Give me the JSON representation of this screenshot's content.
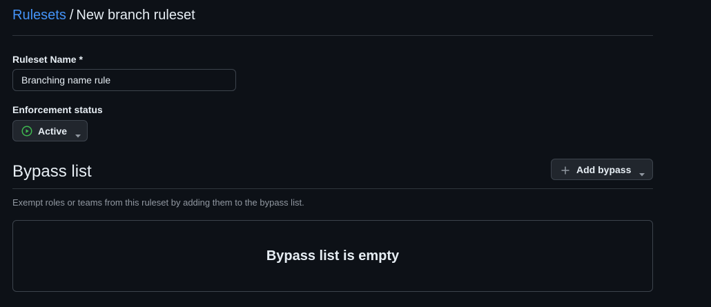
{
  "breadcrumb": {
    "parent": "Rulesets",
    "separator": "/",
    "current": "New branch ruleset"
  },
  "ruleset_name": {
    "label": "Ruleset Name *",
    "value": "Branching name rule"
  },
  "enforcement": {
    "label": "Enforcement status",
    "value": "Active",
    "icon": "play-circle-icon",
    "icon_color": "#3fb950"
  },
  "bypass": {
    "title": "Bypass list",
    "add_button_label": "Add bypass",
    "helper": "Exempt roles or teams from this ruleset by adding them to the bypass list.",
    "empty_message": "Bypass list is empty"
  },
  "colors": {
    "link": "#4493f8",
    "background": "#0d1117",
    "border": "#30363d",
    "button_bg": "#21262d"
  }
}
